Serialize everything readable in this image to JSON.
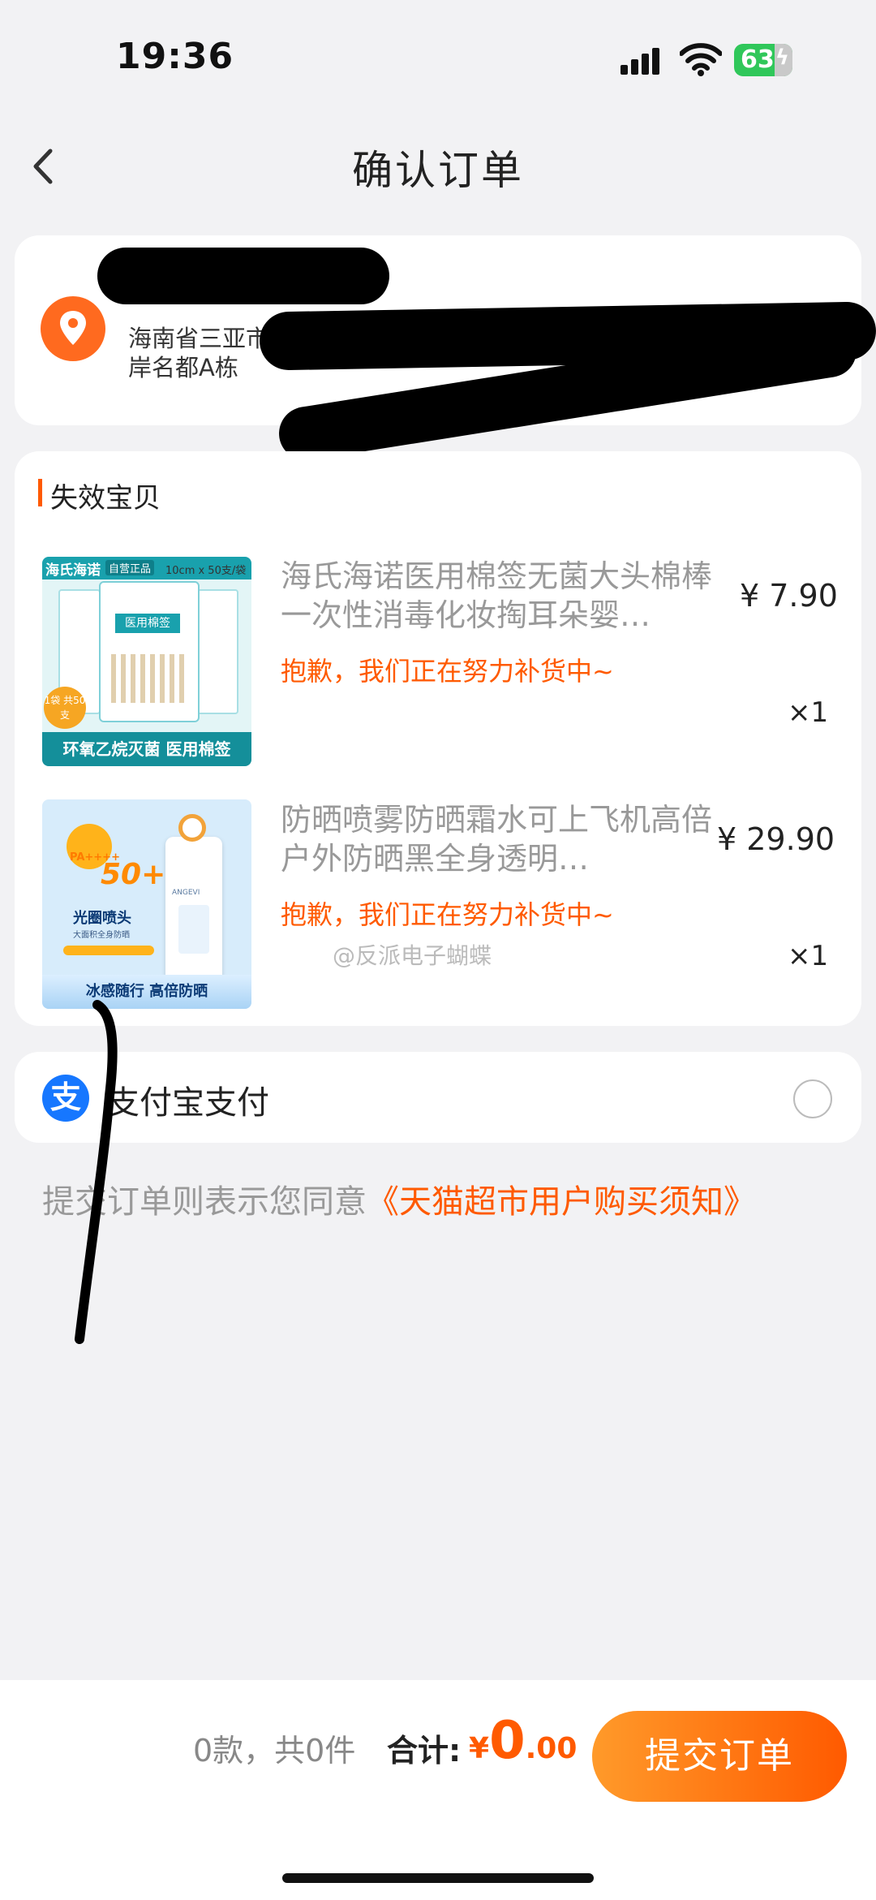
{
  "status_bar": {
    "time": "19:36",
    "battery": "63"
  },
  "nav": {
    "title": "确认订单"
  },
  "address": {
    "line1": "海南省三亚市",
    "line2": "岸名都A栋"
  },
  "section": {
    "title": "失效宝贝"
  },
  "items": [
    {
      "title": "海氏海诺医用棉签无菌大头棉棒一次性消毒化妆掏耳朵婴…",
      "status": "抱歉，我们正在努力补货中~",
      "price": "¥ 7.90",
      "qty": "×1",
      "thumb": {
        "brand": "海氏海诺",
        "badge": "自营正品",
        "spec": "10cm x 50支/袋",
        "pack": "医用棉签",
        "count": "1袋 共50支",
        "caption": "环氧乙烷灭菌 医用棉签"
      }
    },
    {
      "title": "防晒喷雾防晒霜水可上飞机高倍户外防晒黑全身透明…",
      "status": "抱歉，我们正在努力补货中~",
      "price": "¥ 29.90",
      "qty": "×1",
      "thumb": {
        "spf": "50+",
        "pa": "PA++++",
        "name": "光圈喷头",
        "sub": "大面积全身防晒",
        "brand": "ANGEVI",
        "caption": "冰感随行 高倍防晒"
      }
    }
  ],
  "watermark": "@反派电子蝴蝶",
  "payment": {
    "label": "支付宝支付",
    "icon": "alipay-icon"
  },
  "agreement": {
    "prefix": "提交订单则表示您同意",
    "link": "《天猫超市用户购买须知》"
  },
  "footer": {
    "summary": "0款，共0件",
    "total_label": "合计:",
    "currency": "¥",
    "total_int": "0",
    "total_dec": ".00",
    "submit": "提交订单"
  },
  "colors": {
    "accent": "#ff5a00",
    "alipay": "#1677ff",
    "location": "#ff6a1f"
  }
}
